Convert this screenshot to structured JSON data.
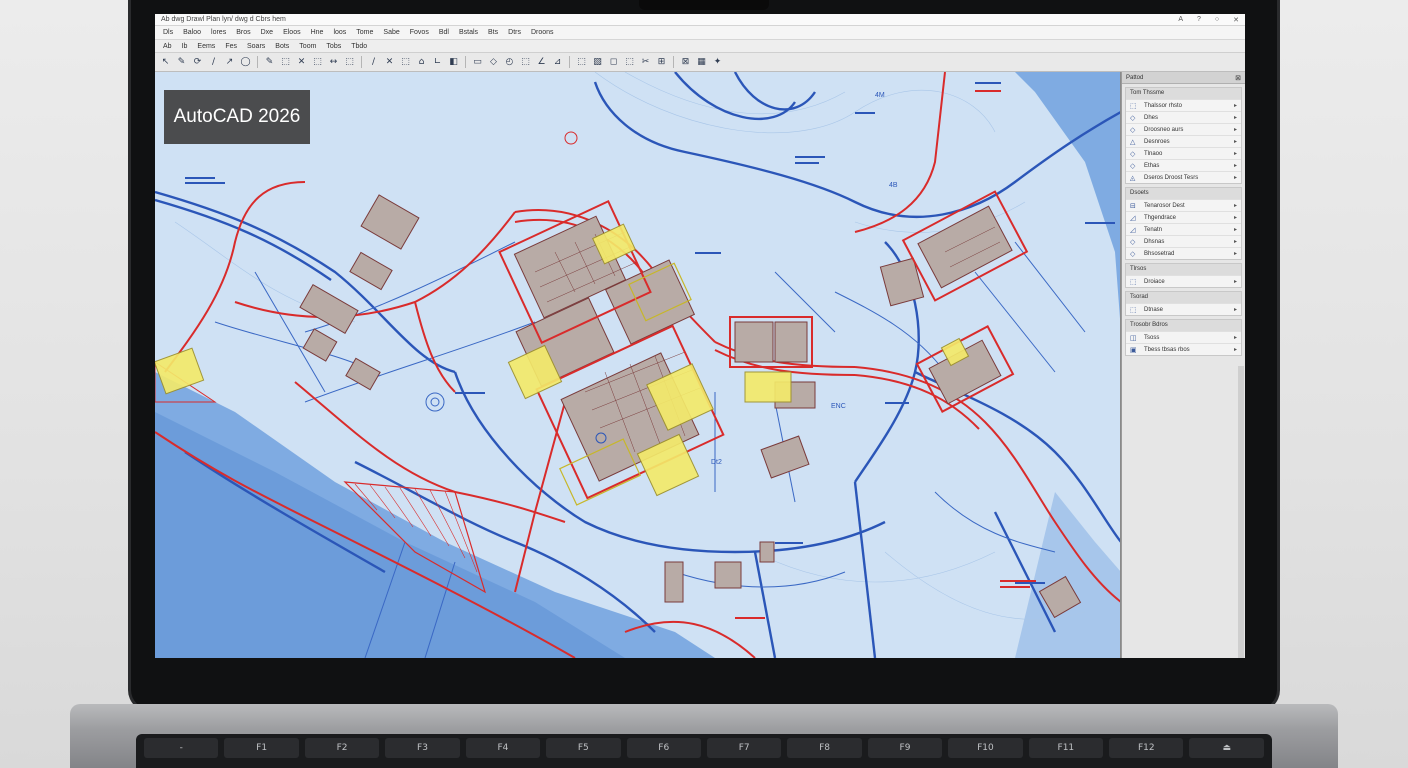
{
  "app": {
    "badge": "AutoCAD 2026",
    "title": "Ab dwg Drawl Plan lyn/ dwg d Cbrs hem",
    "window_controls": [
      "A",
      "?",
      "○",
      "✕"
    ]
  },
  "menubar": [
    "Dls",
    "Baloo",
    "lores",
    "Bros",
    "Dxe",
    "Eloos",
    "Hne",
    "loos",
    "Tome",
    "Sabe",
    "Fovos",
    "Bdl",
    "Bstals",
    "Bts",
    "Dtrs",
    "Droons"
  ],
  "ribbon_tabs": [
    "Ab",
    "Ib",
    "Eems",
    "Fes",
    "Soars",
    "Bots",
    "Toom",
    "Tobs",
    "Tbdo"
  ],
  "toolbar_icons": [
    "↖",
    "✎",
    "⟳",
    "∕",
    "↗",
    "◯",
    "✎",
    "⬚",
    "✕",
    "⬚",
    "↔",
    "⬚",
    "∕",
    "✕",
    "⬚",
    "⌂",
    "∟",
    "◧",
    "▭",
    "◇",
    "◴",
    "⬚",
    "∠",
    "⊿",
    "⬚",
    "▧",
    "◻",
    "⬚",
    "✂",
    "⊞",
    "⊠",
    "▦",
    "✦"
  ],
  "palette": {
    "title": "Pattod",
    "groups": [
      {
        "title": "Tom   Thssme",
        "rows": [
          {
            "icon": "⬚",
            "label": "Thalssor rhsto"
          },
          {
            "icon": "◇",
            "label": "Dhes"
          },
          {
            "icon": "◇",
            "label": "Droosneo aurs"
          },
          {
            "icon": "△",
            "label": "Desnroes"
          },
          {
            "icon": "◇",
            "label": "Tlnaoo"
          },
          {
            "icon": "◇",
            "label": "Ethas"
          },
          {
            "icon": "◬",
            "label": "Dseros Droost Tesrs"
          }
        ]
      },
      {
        "title": "Dsoets",
        "rows": [
          {
            "icon": "⊟",
            "label": "Tenarosor Dest"
          },
          {
            "icon": "◿",
            "label": "Thgendrace"
          },
          {
            "icon": "◿",
            "label": "Tenatn"
          },
          {
            "icon": "◇",
            "label": "Dhsnas"
          },
          {
            "icon": "◇",
            "label": "Bhsosetrad"
          }
        ]
      },
      {
        "title": "Tlrsos",
        "rows": [
          {
            "icon": "⬚",
            "label": "Droiace"
          }
        ]
      },
      {
        "title": "Tsorad",
        "rows": [
          {
            "icon": "⬚",
            "label": "Dtnase"
          }
        ]
      },
      {
        "title": "Trosobr Bdros",
        "rows": [
          {
            "icon": "◫",
            "label": "Tsoss"
          },
          {
            "icon": "▣",
            "label": "Tbess tbsas rbos"
          }
        ]
      }
    ]
  },
  "drawing": {
    "annotations": [
      "4M",
      "4B",
      "ENC",
      "Dt2"
    ]
  },
  "keyboard": {
    "row1": [
      "-",
      "F1",
      "F2",
      "F3",
      "F4",
      "F5",
      "F6",
      "F7",
      "F8",
      "F9",
      "F10",
      "F11",
      "F12",
      "⏏"
    ]
  },
  "colors": {
    "drawing_background": "#cfe1f4",
    "road_blue": "#2b56b8",
    "boundary_red": "#d92b2b",
    "building_fill": "#b8aba6",
    "highlight_yellow": "#f3ea6a",
    "water": "#6d9fdc"
  }
}
